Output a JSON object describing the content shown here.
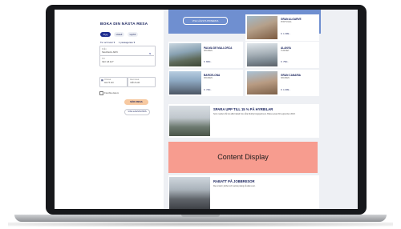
{
  "booking": {
    "title": "BOKA DIN NÄSTA RESA",
    "tabs": [
      "Flyg",
      "Hotell",
      "Hyrbil"
    ],
    "trip_type": "Tur och retur",
    "passengers": "1 passagerare",
    "from_label": "Från",
    "from_value": "Stockholm ARN",
    "to_label": "Till",
    "to_value": "Vart vill du?",
    "depart_label": "Utresa",
    "depart_value": "tors 5 okt",
    "return_label": "Hemresa",
    "return_value": "mån 9 okt",
    "checkbox_label": "Flexibla datum",
    "search_button": "SÖK RESA",
    "lowprice_button": "VISA LÄGSTA PRIS"
  },
  "hero": {
    "button_label": "VISA LÄGSTA PRISERNA"
  },
  "destinations": [
    {
      "name": "GRAN ALGARVE",
      "sub": "PORTUGAL",
      "price": "fr. 1 399:-"
    },
    {
      "name": "PALMA DE MALLORCA",
      "sub": "SPANIEN",
      "price": "fr. 849:-"
    },
    {
      "name": "ALANYA",
      "sub": "TURKIET",
      "price": "fr. 799:-"
    },
    {
      "name": "BARCELONA",
      "sub": "SPANIEN",
      "price": "fr. 749:-"
    },
    {
      "name": "GRAN CANARIA",
      "sub": "SPANIEN",
      "price": "fr. 1 099:-"
    }
  ],
  "promo1": {
    "title": "SPARA UPP TILL 15 % PÅ HYRBILAR",
    "text": "Som medlem får du alltid rabatt hos våra biluthyrningspartners. Boka senast 30 september 2023."
  },
  "content_display": "Content Display",
  "promo2": {
    "title": "RABATT PÅ JOBBRESOR",
    "text": "Res smart i jobbet och samla poäng på alla resor."
  },
  "colors": {
    "brand_navy": "#16205b",
    "accent_blue": "#1c2b8f",
    "search_button": "#f7c9a1",
    "content_display_bg": "#f79c8f"
  }
}
